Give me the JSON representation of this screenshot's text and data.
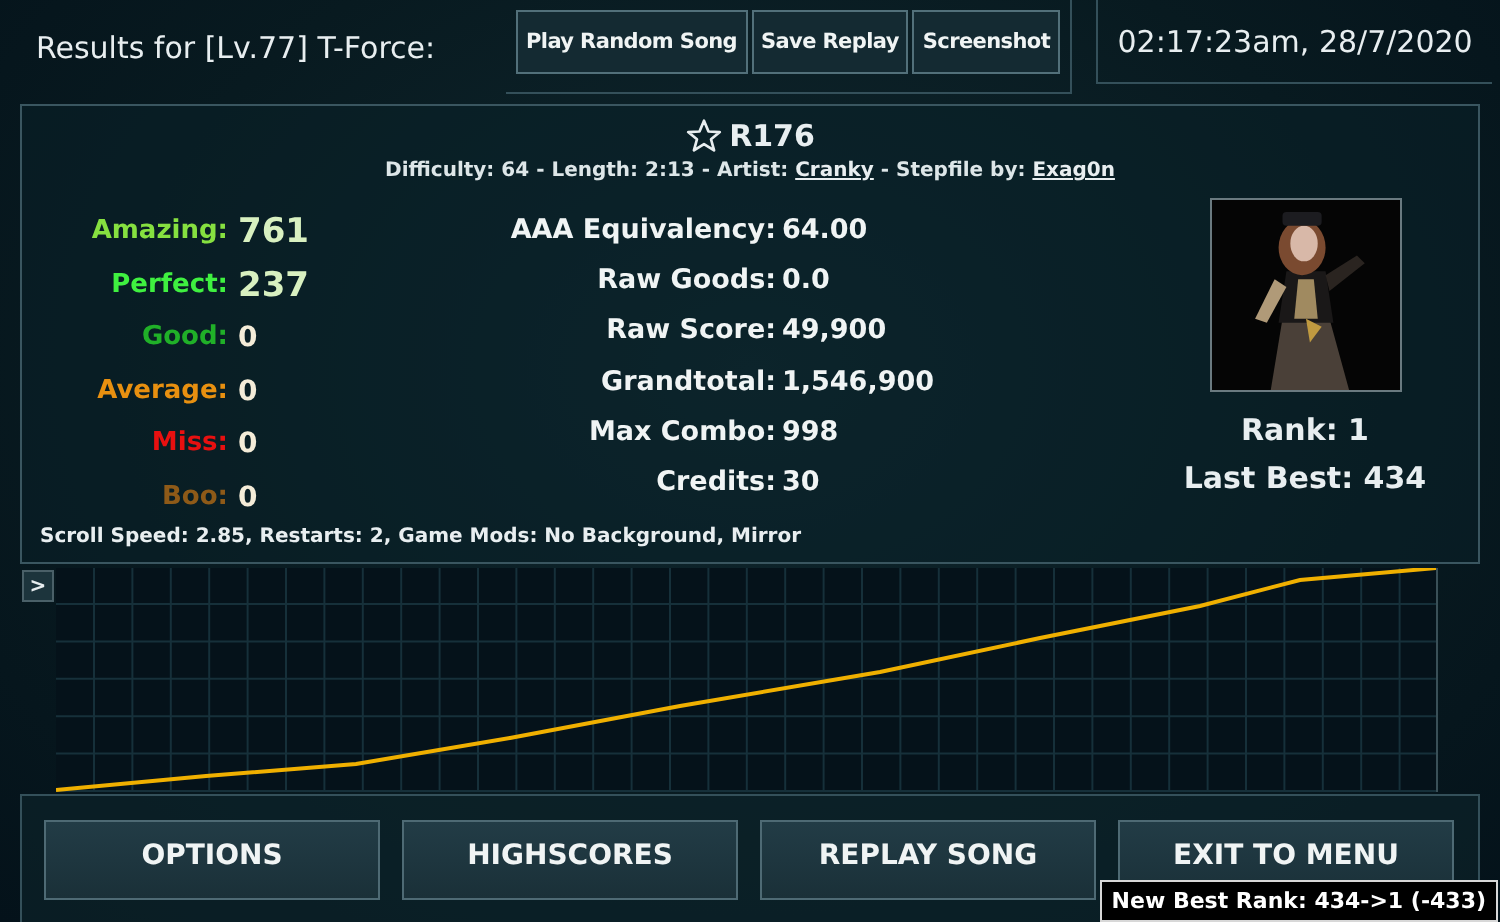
{
  "header": {
    "title": "Results for [Lv.77] T-Force:",
    "buttons": [
      "Play Random Song",
      "Save Replay",
      "Screenshot"
    ],
    "datetime": "02:17:23am, 28/7/2020"
  },
  "song": {
    "favorite": false,
    "title": "R176",
    "info": [
      {
        "kind": "text",
        "text": "Difficulty: 64 - Length: 2:13 - Artist: "
      },
      {
        "kind": "link",
        "text": "Cranky"
      },
      {
        "kind": "text",
        "text": " - Stepfile by: "
      },
      {
        "kind": "link",
        "text": "Exag0n"
      }
    ]
  },
  "judgements": [
    {
      "label": "Amazing:",
      "value": "761",
      "kind": "major",
      "color": "#86e040"
    },
    {
      "label": "Perfect:",
      "value": "237",
      "kind": "major",
      "color": "#3ff040"
    },
    {
      "label": "Good:",
      "value": "0",
      "kind": "minor",
      "color": "#20b028"
    },
    {
      "label": "Average:",
      "value": "0",
      "kind": "minor",
      "color": "#e89010"
    },
    {
      "label": "Miss:",
      "value": "0",
      "kind": "minor",
      "color": "#e81010"
    },
    {
      "label": "Boo:",
      "value": "0",
      "kind": "minor",
      "color": "#8e5a18"
    }
  ],
  "stats": [
    {
      "label": "AAA Equivalency:",
      "value": "64.00"
    },
    {
      "label": "Raw Goods:",
      "value": "0.0"
    },
    {
      "label": "Raw Score:",
      "value": "49,900"
    },
    {
      "label": "Grandtotal:",
      "value": "1,546,900"
    },
    {
      "label": "Max Combo:",
      "value": "998"
    },
    {
      "label": "Credits:",
      "value": "30"
    }
  ],
  "rank": {
    "rank": "Rank: 1",
    "last_best": "Last Best: 434"
  },
  "settings": "Scroll Speed: 2.85, Restarts: 2, Game Mods: No Background, Mirror",
  "graph": {
    "toggle": ">"
  },
  "actions": [
    "OPTIONS",
    "HIGHSCORES",
    "REPLAY SONG",
    "EXIT TO MENU"
  ],
  "toast": "New Best Rank: 434->1 (-433)"
}
